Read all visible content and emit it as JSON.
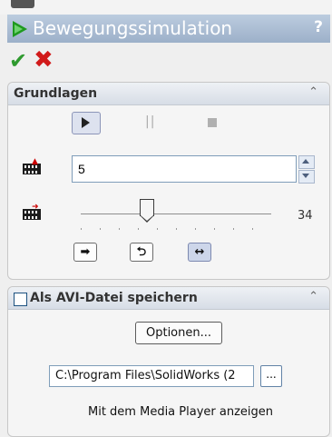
{
  "window": {
    "title": "Bewegungssimulation",
    "help_label": "?"
  },
  "actions": {
    "ok_symbol": "✔",
    "cancel_symbol": "✖"
  },
  "basics": {
    "title": "Grundlagen",
    "collapse_symbol": "⌃",
    "frame_value": "5",
    "slider_position_value": 34,
    "slider_label": "34"
  },
  "avi": {
    "title": "Als AVI-Datei speichern",
    "checked": true,
    "checkbox_symbol": "✓",
    "collapse_symbol": "⌃",
    "options_label": "Optionen...",
    "path_value": "C:\\Program Files\\SolidWorks (2",
    "browse_label": "...",
    "media_player_label": "Mit dem Media Player anzeigen",
    "media_player_checked": false
  },
  "colors": {
    "title_bar": "#a9bbd1",
    "ok_green": "#2f9a2f",
    "cancel_red": "#d11a1a"
  }
}
